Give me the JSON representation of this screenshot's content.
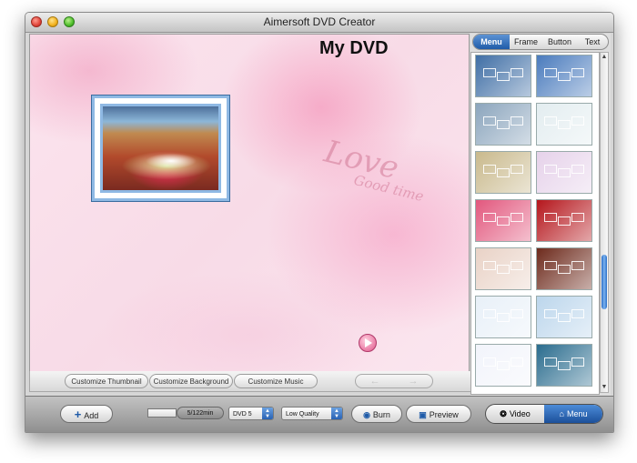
{
  "window": {
    "title": "Aimersoft DVD Creator"
  },
  "canvas": {
    "title": "My DVD",
    "decor_text": "Love",
    "decor_sub": "Good time",
    "toolbar": {
      "customize_thumbnail": "Customize Thumbnail",
      "customize_background": "Customize Background",
      "customize_music": "Customize Music",
      "prev_icon": "left-arrow-icon",
      "next_icon": "right-arrow-icon"
    }
  },
  "right_panel": {
    "tabs": [
      {
        "label": "Menu",
        "active": true
      },
      {
        "label": "Frame",
        "active": false
      },
      {
        "label": "Button",
        "active": false
      },
      {
        "label": "Text",
        "active": false
      }
    ],
    "templates": [
      {
        "name": "template-1",
        "color": "#3f6ea5"
      },
      {
        "name": "template-2",
        "color": "#4a7bbd"
      },
      {
        "name": "template-3",
        "color": "#8ba5bd"
      },
      {
        "name": "template-4",
        "color": "#e3edf0"
      },
      {
        "name": "template-5",
        "color": "#c9b98c"
      },
      {
        "name": "template-6",
        "color": "#e6d2ea"
      },
      {
        "name": "template-7",
        "color": "#e2577d"
      },
      {
        "name": "template-8",
        "color": "#b5161c"
      },
      {
        "name": "template-9",
        "color": "#e9d2c6"
      },
      {
        "name": "template-10",
        "color": "#6d2a1c"
      },
      {
        "name": "template-11",
        "color": "#e8f0f8"
      },
      {
        "name": "template-12",
        "color": "#bcd6ec"
      },
      {
        "name": "template-13",
        "color": "#f2f4fb"
      },
      {
        "name": "template-14",
        "color": "#2a6c8e"
      }
    ]
  },
  "bottom_bar": {
    "add_label": "Add",
    "capacity_label": "5/122min",
    "disc_type": "DVD 5",
    "quality": "Low Quality",
    "burn_label": "Burn",
    "preview_label": "Preview",
    "video_label": "Video",
    "menu_label": "Menu"
  },
  "colors": {
    "accent": "#1f5ba8",
    "canvas_bg": "#f8dbe7"
  }
}
